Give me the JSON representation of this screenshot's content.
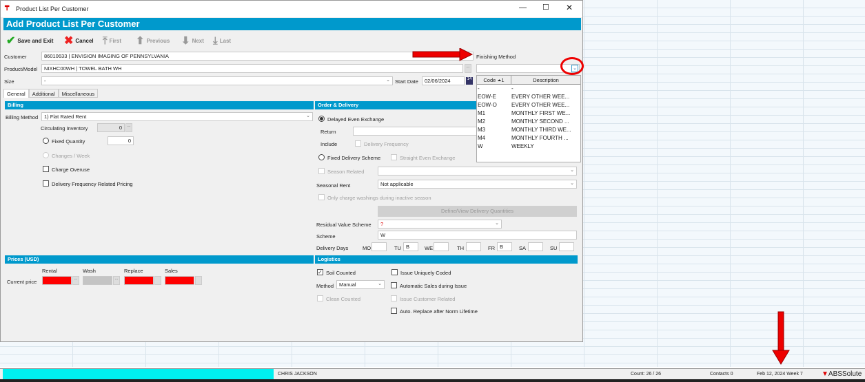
{
  "window": {
    "title": "Product List Per Customer",
    "header": "Add Product List Per Customer"
  },
  "toolbar": {
    "save": "Save and Exit",
    "cancel": "Cancel",
    "first": "First",
    "previous": "Previous",
    "next": "Next",
    "last": "Last"
  },
  "form": {
    "customer_label": "Customer",
    "customer_value": "86010633     | ENVISION IMAGING OF PENNSYLVANIA",
    "product_label": "Product/Model",
    "product_value": "NIXHC00WH     | TOWEL BATH WH",
    "size_label": "Size",
    "size_value": "-",
    "start_date_label": "Start Date",
    "start_date_value": "02/06/2024",
    "finishing_label": "Finishing Method"
  },
  "tabs": [
    "General",
    "Additional",
    "Miscellaneous"
  ],
  "finishing_dropdown": {
    "headers": [
      "Code",
      "Description"
    ],
    "sort_indicator": "1",
    "rows": [
      [
        "-",
        "-"
      ],
      [
        "EOW-E",
        "EVERY OTHER WEE..."
      ],
      [
        "EOW-O",
        "EVERY OTHER WEE..."
      ],
      [
        "M1",
        "MONTHLY FIRST WE..."
      ],
      [
        "M2",
        "MONTHLY SECOND ..."
      ],
      [
        "M3",
        "MONTHLY THIRD WE..."
      ],
      [
        "M4",
        "MONTHLY FOURTH ..."
      ],
      [
        "W",
        "WEEKLY"
      ]
    ]
  },
  "billing": {
    "title": "Billing",
    "method_label": "Billing Method",
    "method_value": "1) Flat Rated Rent",
    "circ_label": "Circulating Inventory",
    "circ_value": "0",
    "fixed_label": "Fixed Quantity",
    "fixed_value": "0",
    "changes_label": "Changes / Week",
    "overuse_label": "Charge Overuse",
    "dfrp_label": "Delivery Frequency Related Pricing"
  },
  "order": {
    "title": "Order & Delivery",
    "delayed_label": "Delayed Even Exchange",
    "return_label": "Return",
    "include_label": "Include",
    "delivery_freq_label": "Delivery Frequency",
    "fixed_scheme_label": "Fixed Delivery Scheme",
    "straight_label": "Straight Even Exchange",
    "season_related_label": "Season Related",
    "seasonal_rent_label": "Seasonal Rent",
    "seasonal_rent_value": "Not applicable",
    "only_charge_label": "Only charge washings during inactive season",
    "define_button": "Define/View Delivery Quantities",
    "residual_label": "Residual Value Scheme",
    "residual_value": "?",
    "scheme_label": "Scheme",
    "scheme_value": "W",
    "days_label": "Delivery Days",
    "days": [
      {
        "d": "MO",
        "v": ""
      },
      {
        "d": "TU",
        "v": "B"
      },
      {
        "d": "WE",
        "v": ""
      },
      {
        "d": "TH",
        "v": ""
      },
      {
        "d": "FR",
        "v": "B"
      },
      {
        "d": "SA",
        "v": ""
      },
      {
        "d": "SU",
        "v": ""
      }
    ]
  },
  "prices": {
    "title": "Prices (USD)",
    "cols": [
      "Rental",
      "Wash",
      "Replace",
      "Sales"
    ],
    "row_label": "Current price"
  },
  "logistics": {
    "title": "Logistics",
    "soil_label": "Soil Counted",
    "method_label": "Method",
    "method_value": "Manual",
    "clean_label": "Clean Counted",
    "unique_label": "Issue Uniquely Coded",
    "auto_sales_label": "Automatic Sales during Issue",
    "cust_rel_label": "Issue Customer Related",
    "auto_replace_label": "Auto. Replace after Norm Lifetime"
  },
  "status": {
    "user": "CHRIS JACKSON",
    "count": "Count: 26 / 26",
    "contacts": "Contacts 0",
    "date": "Feb 12, 2024 Week 7",
    "brand": "ABSSolute"
  },
  "colors": {
    "accent": "#0099cc",
    "annotation": "#e00000"
  }
}
